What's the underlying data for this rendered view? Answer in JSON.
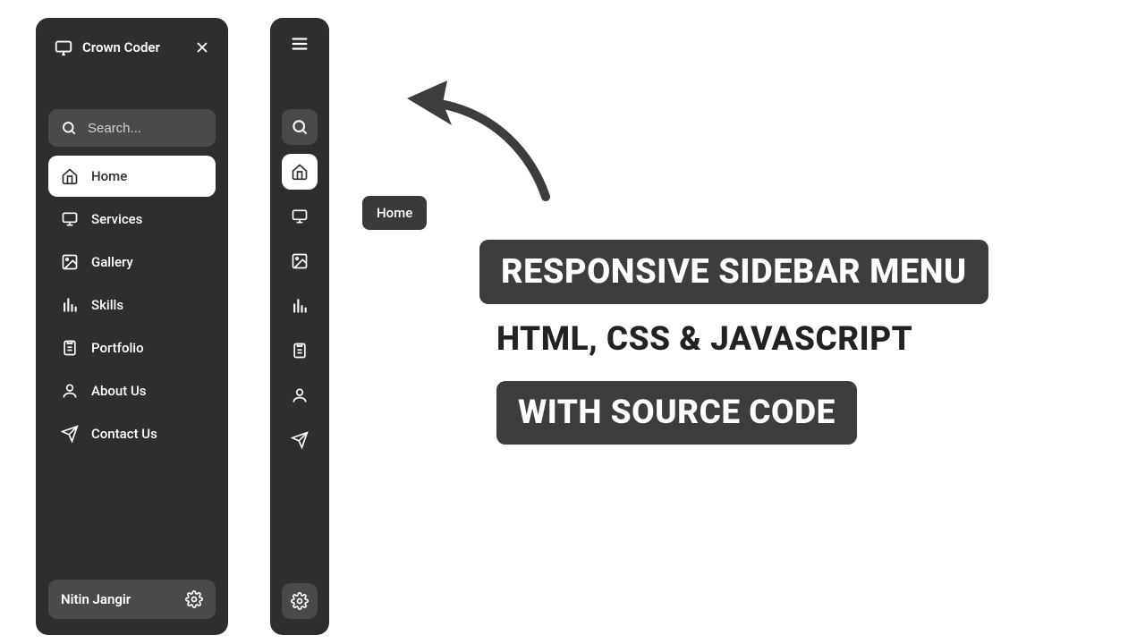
{
  "brand": "Crown Coder",
  "search": {
    "placeholder": "Search..."
  },
  "nav": [
    {
      "label": "Home"
    },
    {
      "label": "Services"
    },
    {
      "label": "Gallery"
    },
    {
      "label": "Skills"
    },
    {
      "label": "Portfolio"
    },
    {
      "label": "About Us"
    },
    {
      "label": "Contact Us"
    }
  ],
  "user": {
    "name": "Nitin Jangir"
  },
  "tooltip": "Home",
  "titles": {
    "line1": "RESPONSIVE SIDEBAR MENU",
    "line2": "HTML, CSS & JAVASCRIPT",
    "line3": "WITH SOURCE CODE"
  }
}
